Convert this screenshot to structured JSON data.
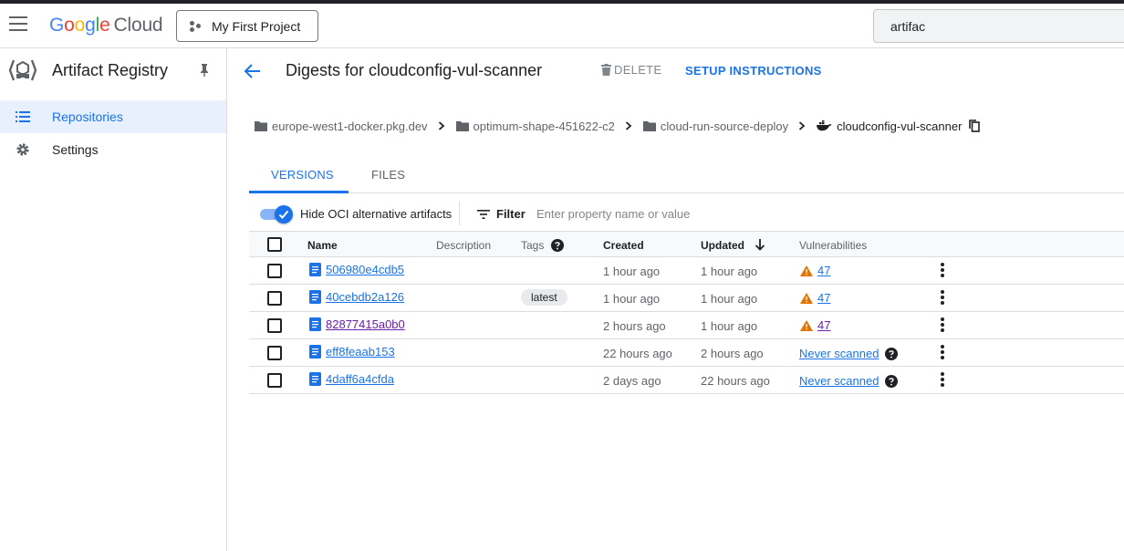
{
  "header": {
    "logo": {
      "g1": "G",
      "g2": "o",
      "g3": "o",
      "g4": "g",
      "g5": "l",
      "g6": "e",
      "cloud": "Cloud"
    },
    "project_label": "My First Project",
    "search_value": "artifac"
  },
  "sidebar": {
    "title": "Artifact Registry",
    "items": [
      {
        "label": "Repositories",
        "icon": "list-icon",
        "active": true
      },
      {
        "label": "Settings",
        "icon": "gear-icon",
        "active": false
      }
    ]
  },
  "page": {
    "title": "Digests for cloudconfig-vul-scanner",
    "delete_label": "DELETE",
    "setup_label": "SETUP INSTRUCTIONS"
  },
  "breadcrumb": [
    {
      "label": "europe-west1-docker.pkg.dev",
      "icon": "folder-icon"
    },
    {
      "label": "optimum-shape-451622-c2",
      "icon": "folder-icon"
    },
    {
      "label": "cloud-run-source-deploy",
      "icon": "folder-icon"
    },
    {
      "label": "cloudconfig-vul-scanner",
      "icon": "docker-icon"
    }
  ],
  "tabs": [
    {
      "label": "VERSIONS",
      "active": true
    },
    {
      "label": "FILES",
      "active": false
    }
  ],
  "filterbar": {
    "toggle_label": "Hide OCI alternative artifacts",
    "toggle_on": true,
    "filter_label": "Filter",
    "filter_placeholder": "Enter property name or value"
  },
  "table": {
    "columns": {
      "name": "Name",
      "description": "Description",
      "tags": "Tags",
      "created": "Created",
      "updated": "Updated",
      "vulnerabilities": "Vulnerabilities"
    },
    "rows": [
      {
        "name": "506980e4cdb5",
        "tag": "",
        "created": "1 hour ago",
        "updated": "1 hour ago",
        "vulns": "47",
        "visited": false
      },
      {
        "name": "40cebdb2a126",
        "tag": "latest",
        "created": "1 hour ago",
        "updated": "1 hour ago",
        "vulns": "47",
        "visited": false
      },
      {
        "name": "82877415a0b0",
        "tag": "",
        "created": "2 hours ago",
        "updated": "1 hour ago",
        "vulns": "47",
        "visited": true
      },
      {
        "name": "eff8feaab153",
        "tag": "",
        "created": "22 hours ago",
        "updated": "2 hours ago",
        "never": "Never scanned",
        "visited": false
      },
      {
        "name": "4daff6a4cfda",
        "tag": "",
        "created": "2 days ago",
        "updated": "22 hours ago",
        "never": "Never scanned",
        "visited": false
      }
    ]
  },
  "colors": {
    "accent": "#1a73e8",
    "visited_link": "#681da8",
    "warning": "#e37400",
    "active_nav_bg": "#e8f0fe"
  }
}
